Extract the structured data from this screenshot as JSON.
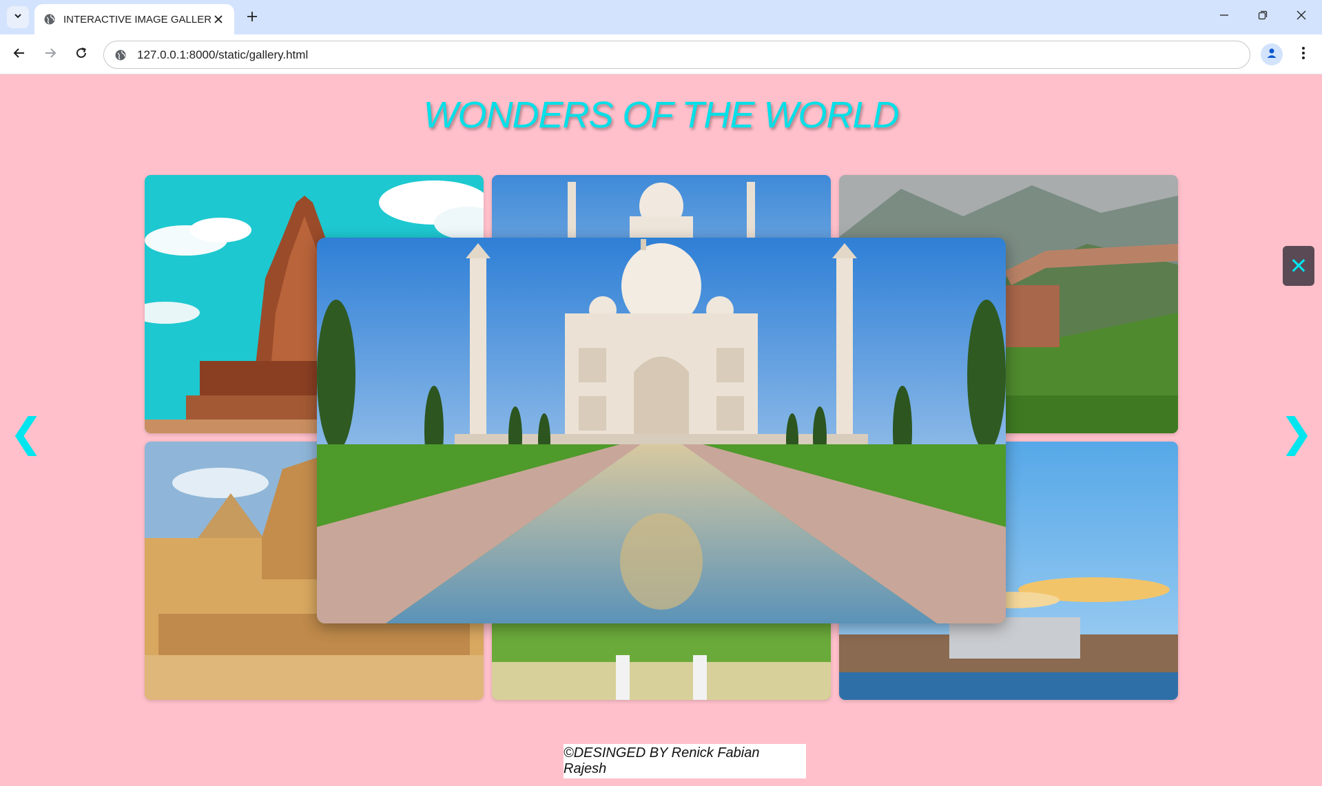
{
  "browser": {
    "tab_title": "INTERACTIVE IMAGE GALLERY",
    "url": "127.0.0.1:8000/static/gallery.html",
    "icons": {
      "tab_search": "chevron-down-icon",
      "favicon": "globe-icon",
      "tab_close": "close-icon",
      "new_tab": "plus-icon",
      "back": "arrow-left-icon",
      "forward": "arrow-right-icon",
      "reload": "reload-icon",
      "site_info": "site-info-icon",
      "profile": "person-icon",
      "menu": "kebab-menu-icon"
    }
  },
  "page": {
    "heading": "WONDERS OF THE WORLD",
    "gallery": {
      "images": [
        {
          "subject": "temple"
        },
        {
          "subject": "taj-mahal"
        },
        {
          "subject": "great-wall"
        },
        {
          "subject": "sphinx"
        },
        {
          "subject": "eiffel-gardens"
        },
        {
          "subject": "waterfront"
        }
      ]
    },
    "lightbox": {
      "subject": "taj-mahal"
    },
    "controls": {
      "close_glyph": "✕",
      "prev_glyph": "❮",
      "next_glyph": "❯"
    },
    "footer": "©DESINGED BY Renick Fabian Rajesh"
  },
  "colors": {
    "page_background": "#ffc0cb",
    "accent": "#00e5ee",
    "close_button_background": "#5a4a55"
  }
}
